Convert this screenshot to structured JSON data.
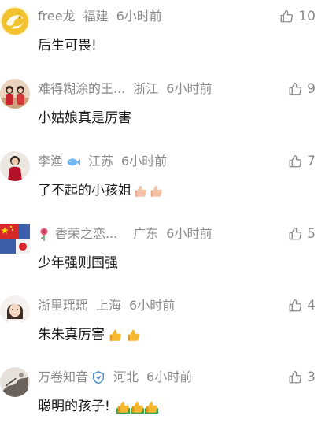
{
  "comments": [
    {
      "username": "free龙",
      "region": "福建",
      "time": "6小时前",
      "likes": "10",
      "text": "后生可畏!",
      "emoji": [],
      "avatar_icon": "golden-dragon-avatar"
    },
    {
      "username": "难得糊涂的王...",
      "region": "浙江",
      "time": "6小时前",
      "likes": "9",
      "text": "小姑娘真是厉害",
      "emoji": [],
      "avatar_icon": "couple-photo-avatar"
    },
    {
      "username": "李渔",
      "badge": "fish-icon",
      "region": "江苏",
      "time": "6小时前",
      "likes": "7",
      "text": "了不起的小孩姐",
      "emoji": [
        "thumbs-up-icon",
        "thumbs-up-icon"
      ],
      "avatar_icon": "person-in-red-avatar"
    },
    {
      "username": "香荣之恋...",
      "prefix_icon": "rose-icon",
      "region": "广东",
      "time": "6小时前",
      "likes": "5",
      "text": "少年强则国强",
      "emoji": [],
      "avatar_icon": "flag-avatar"
    },
    {
      "username": "浙里瑶瑶",
      "region": "上海",
      "time": "6小时前",
      "likes": "4",
      "text": "朱朱真厉害",
      "emoji": [
        "yellow-thumbs-up-icon",
        "yellow-thumbs-up-icon"
      ],
      "avatar_icon": "woman-portrait-avatar"
    },
    {
      "username": "万卷知音",
      "badge": "shield-badge-icon",
      "region": "河北",
      "time": "6小时前",
      "likes": "3",
      "text": "聪明的孩子!",
      "emoji": [
        "green-thumbs-up-icon",
        "green-thumbs-up-icon",
        "green-thumbs-up-icon"
      ],
      "avatar_icon": "ink-painting-avatar"
    }
  ],
  "colors": {
    "meta_text": "#8a8a8a",
    "body_text": "#1a1a1a",
    "background": "#ffffff"
  }
}
